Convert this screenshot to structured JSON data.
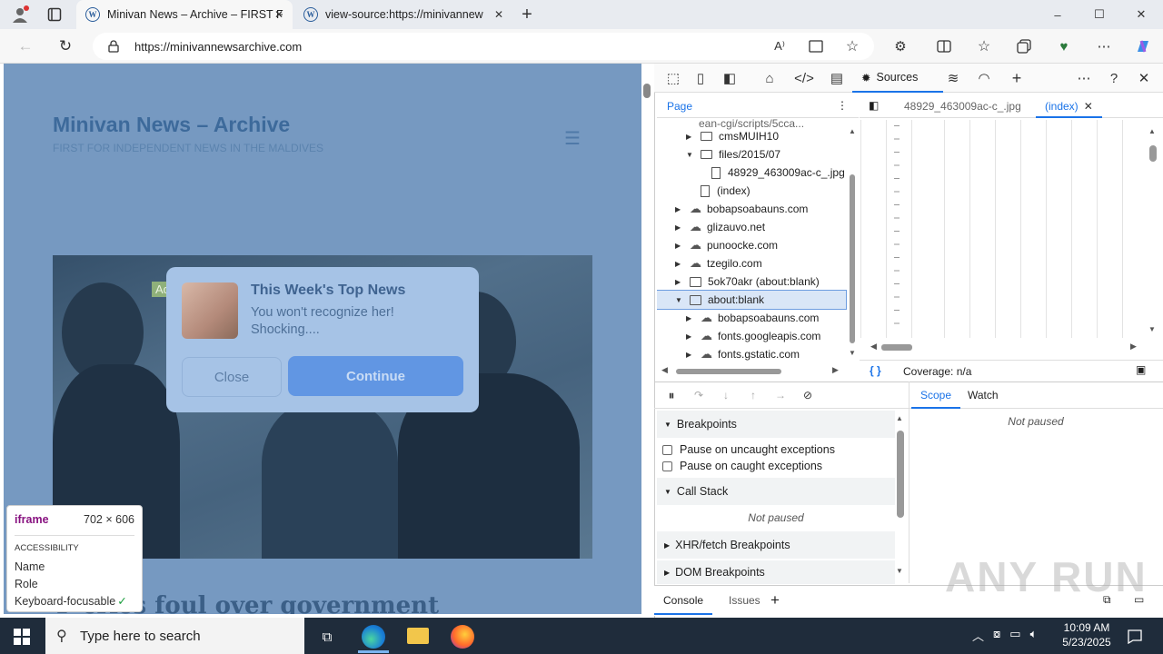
{
  "browser": {
    "tabs": [
      {
        "title": "Minivan News – Archive – FIRST F",
        "active": true
      },
      {
        "title": "view-source:https://minivannew",
        "active": false
      }
    ],
    "url": "https://minivannewsarchive.com",
    "window_controls": {
      "minimize": "–",
      "maximize": "☐",
      "close": "✕"
    }
  },
  "page": {
    "site_title": "Minivan News – Archive",
    "tagline": "FIRST FOR INDEPENDENT NEWS IN THE MALDIVES",
    "headline": "P cries foul over government",
    "ad": {
      "label": "Ad",
      "title": "This Week's Top News",
      "body": "You won't recognize her! Shocking....",
      "close": "Close",
      "continue": "Continue"
    }
  },
  "inspector_tooltip": {
    "element": "iframe",
    "size": "702 × 606",
    "section": "ACCESSIBILITY",
    "rows": [
      "Name",
      "Role",
      "Keyboard-focusable"
    ]
  },
  "devtools": {
    "active_tab": "Sources",
    "navigator_tab": "Page",
    "file_tabs": [
      "48929_463009ac-c_.jpg",
      "(index)"
    ],
    "tree": [
      {
        "label": "cmsMUIH10",
        "indent": 1,
        "type": "folder",
        "open": false
      },
      {
        "label": "files/2015/07",
        "indent": 1,
        "type": "folder",
        "open": true
      },
      {
        "label": "48929_463009ac-c_.jpg",
        "indent": 2,
        "type": "file"
      },
      {
        "label": "(index)",
        "indent": 1,
        "type": "file"
      },
      {
        "label": "bobapsoabauns.com",
        "indent": 0,
        "type": "cloud",
        "open": false
      },
      {
        "label": "glizauvo.net",
        "indent": 0,
        "type": "cloud",
        "open": false
      },
      {
        "label": "punoocke.com",
        "indent": 0,
        "type": "cloud",
        "open": false
      },
      {
        "label": "tzegilo.com",
        "indent": 0,
        "type": "cloud",
        "open": false
      },
      {
        "label": "5ok70akr (about:blank)",
        "indent": 0,
        "type": "frame",
        "open": false
      },
      {
        "label": "about:blank",
        "indent": 0,
        "type": "frame",
        "open": true,
        "selected": true
      },
      {
        "label": "bobapsoabauns.com",
        "indent": 1,
        "type": "cloud",
        "open": false
      },
      {
        "label": "fonts.googleapis.com",
        "indent": 1,
        "type": "cloud",
        "open": false
      },
      {
        "label": "fonts.gstatic.com",
        "indent": 1,
        "type": "cloud",
        "open": false
      }
    ],
    "coverage": "Coverage: n/a",
    "debugger": {
      "breakpoints": "Breakpoints",
      "pause_uncaught": "Pause on uncaught exceptions",
      "pause_caught": "Pause on caught exceptions",
      "call_stack": "Call Stack",
      "not_paused": "Not paused",
      "xhr": "XHR/fetch Breakpoints",
      "dom": "DOM Breakpoints",
      "scope": "Scope",
      "watch": "Watch",
      "scope_status": "Not paused"
    },
    "drawer": {
      "console": "Console",
      "issues": "Issues"
    }
  },
  "watermark": "ANY RUN",
  "taskbar": {
    "search": "Type here to search",
    "time": "10:09 AM",
    "date": "5/23/2025"
  }
}
